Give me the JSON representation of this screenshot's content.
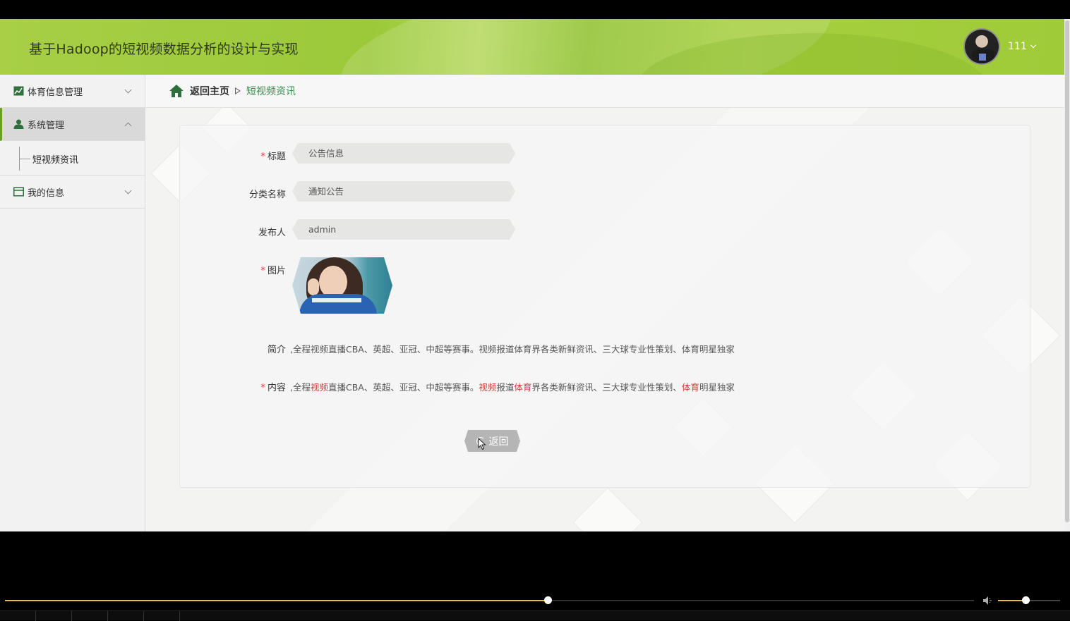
{
  "header": {
    "title": "基于Hadoop的短视频数据分析的设计与实现",
    "user_name": "111"
  },
  "sidebar": {
    "items": [
      {
        "label": "体育信息管理",
        "icon": "chart-icon",
        "expanded": false
      },
      {
        "label": "系统管理",
        "icon": "user-icon",
        "expanded": true,
        "active": true
      },
      {
        "label": "我的信息",
        "icon": "card-icon",
        "expanded": false
      }
    ],
    "submenu": {
      "label": "短视频资讯"
    }
  },
  "breadcrumb": {
    "home": "返回主页",
    "current": "短视频资讯"
  },
  "form": {
    "title_label": "标题",
    "title_value": "公告信息",
    "category_label": "分类名称",
    "category_value": "通知公告",
    "publisher_label": "发布人",
    "publisher_value": "admin",
    "image_label": "图片",
    "summary_label": "简介",
    "summary_value": ",全程视频直播CBA、英超、亚冠、中超等赛事。视频报道体育界各类新鲜资讯、三大球专业性策划、体育明星独家",
    "content_label": "内容",
    "content_parts": [
      ",全程",
      "视频",
      "直播CBA、英超、亚冠、中超等赛事。",
      "视频",
      "报道",
      "体育",
      "界各类新鲜资讯、三大球专业性策划、",
      "体育",
      "明星独家"
    ],
    "back_button": "返回"
  },
  "colors": {
    "accent": "#9bc93a",
    "required": "#e13b3b",
    "highlight": "#c9413c",
    "breadcrumb_current": "#3a8a4c"
  },
  "player": {
    "progress": 0.56,
    "volume": 0.44
  }
}
